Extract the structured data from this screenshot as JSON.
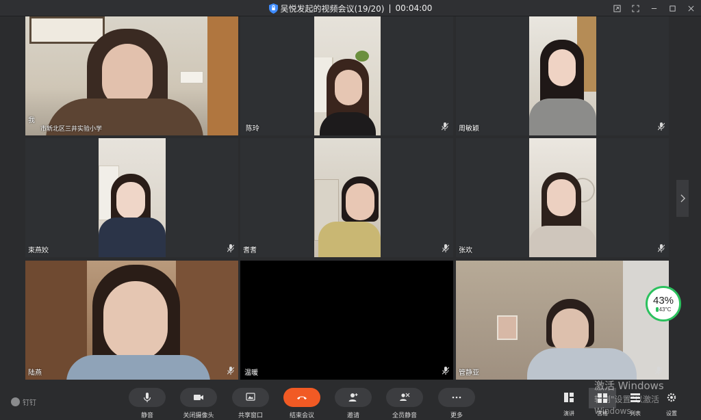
{
  "window": {
    "title": "吴悦发起的视频会议(19/20)",
    "separator": "|",
    "timer": "00:04:00"
  },
  "participants": [
    {
      "name": "我",
      "subtitle": "市新北区三井实验小学"
    },
    {
      "name": "陈玲"
    },
    {
      "name": "周敏颖"
    },
    {
      "name": "束燕姣"
    },
    {
      "name": "耆耆"
    },
    {
      "name": "张欢"
    },
    {
      "name": "陆燕"
    },
    {
      "name": "温暖"
    },
    {
      "name": "管静亚"
    }
  ],
  "performance": {
    "cpu": "43%",
    "temperature": "43°C",
    "color": "#2bc15e"
  },
  "brand": {
    "label": "钉钉"
  },
  "toolbar": {
    "mute": "静音",
    "camera_off": "关闭摄像头",
    "share_window": "共享窗口",
    "end_meeting": "结束会议",
    "invite": "邀请",
    "mute_all": "全员静音",
    "more": "更多",
    "end_color": "#f15a24"
  },
  "right_toolbar": {
    "speaker": "演讲",
    "grid": "宫格",
    "list": "列表",
    "settings": "设置"
  },
  "watermark": {
    "line1": "激活 Windows",
    "line2": "转到\"设置\"以激活 Windows。"
  }
}
